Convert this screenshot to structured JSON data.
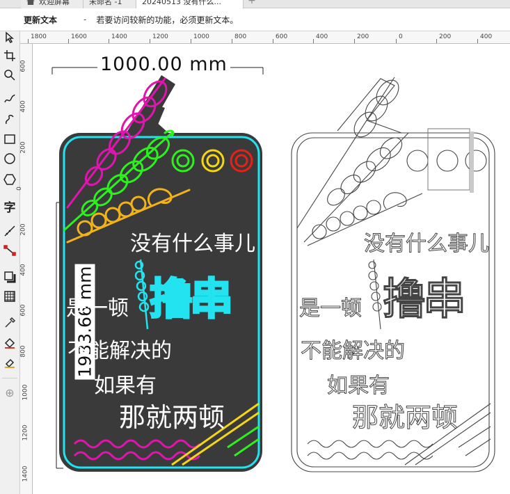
{
  "tabs": [
    {
      "label": "欢迎屏幕",
      "active": false
    },
    {
      "label": "未命名 -1",
      "active": false
    },
    {
      "label": "20240513 没有什么...",
      "active": true
    }
  ],
  "notification": {
    "title": "更新文本",
    "separator": "-",
    "message": "若要访问较新的功能，必须更新文本。"
  },
  "ruler_top": [
    "1800",
    "1600",
    "1400",
    "1200",
    "1000",
    "800",
    "600",
    "400",
    "200",
    "0",
    "200",
    "400"
  ],
  "ruler_left": [
    "600",
    "400",
    "200",
    "0",
    "200",
    "400",
    "600",
    "800",
    "1000",
    "1200",
    "1400"
  ],
  "dimensions": {
    "width": "1000.00 mm",
    "height": "1933.66 mm"
  },
  "artwork": {
    "line1": "没有什么事儿",
    "line2a": "是一顿",
    "line2b": "撸串",
    "line3": "不能解决的",
    "line4": "如果有",
    "line5": "那就两顿"
  },
  "colors": {
    "board": "#3a3a3a",
    "cyan": "#22e3ef",
    "magenta": "#e015b0",
    "green": "#2df11f",
    "yellow": "#f3d614",
    "orange": "#f2b21a",
    "red": "#e62218"
  }
}
